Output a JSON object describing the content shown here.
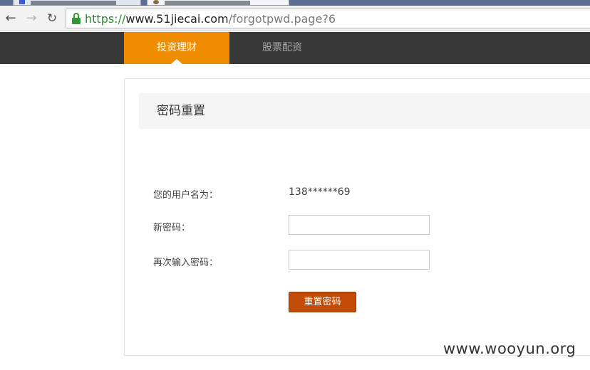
{
  "browser": {
    "url_scheme": "https://",
    "url_host": "www.51jiecai.com",
    "url_path": "/forgotpwd.page?6"
  },
  "site_nav": {
    "tabs": [
      {
        "label": "投资理财",
        "active": true
      },
      {
        "label": "股票配资",
        "active": false
      }
    ]
  },
  "form": {
    "title": "密码重置",
    "username_label": "您的用户名为：",
    "username_value": "138******69",
    "new_password_label": "新密码：",
    "new_password_value": "",
    "confirm_password_label": "再次输入密码：",
    "confirm_password_value": "",
    "submit_label": "重置密码"
  },
  "watermark": "www.wooyun.org",
  "colors": {
    "accent": "#f08c00",
    "button": "#c14c07",
    "nav_bg": "#383838"
  }
}
